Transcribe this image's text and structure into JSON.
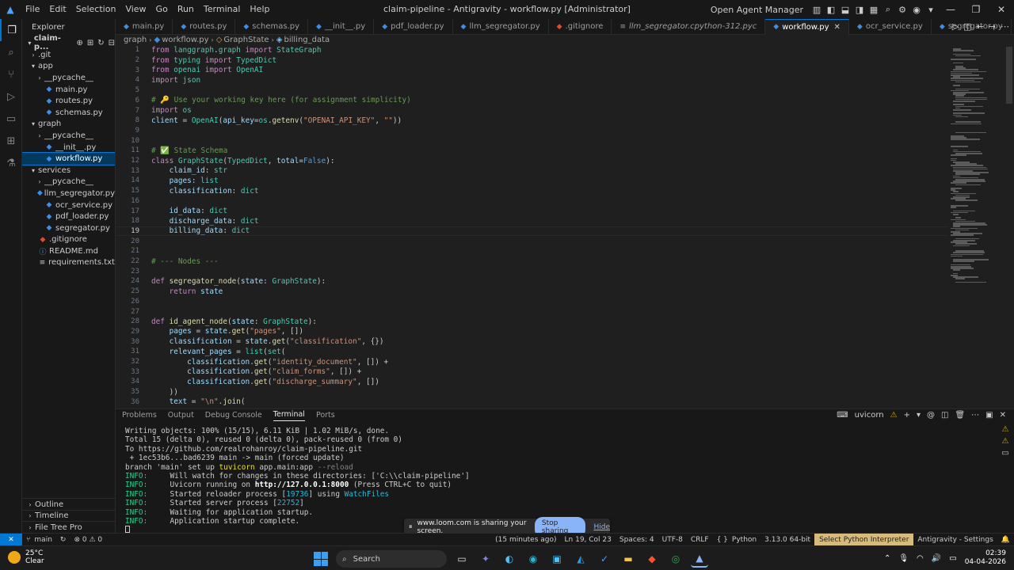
{
  "titlebar": {
    "menu": [
      "File",
      "Edit",
      "Selection",
      "View",
      "Go",
      "Run",
      "Terminal",
      "Help"
    ],
    "title": "claim-pipeline - Antigravity - workflow.py [Administrator]",
    "agent_manager": "Open Agent Manager"
  },
  "sidebar": {
    "header": "Explorer",
    "root": "claim-p...",
    "items": [
      {
        "label": ".git",
        "type": "folder",
        "depth": 1,
        "open": false
      },
      {
        "label": "app",
        "type": "folder",
        "depth": 1,
        "open": true
      },
      {
        "label": "__pycache__",
        "type": "folder",
        "depth": 2,
        "open": false
      },
      {
        "label": "main.py",
        "type": "py",
        "depth": 2
      },
      {
        "label": "routes.py",
        "type": "py",
        "depth": 2
      },
      {
        "label": "schemas.py",
        "type": "py",
        "depth": 2
      },
      {
        "label": "graph",
        "type": "folder",
        "depth": 1,
        "open": true
      },
      {
        "label": "__pycache__",
        "type": "folder",
        "depth": 2,
        "open": false
      },
      {
        "label": "__init__.py",
        "type": "py",
        "depth": 2
      },
      {
        "label": "workflow.py",
        "type": "py",
        "depth": 2,
        "selected": true
      },
      {
        "label": "services",
        "type": "folder",
        "depth": 1,
        "open": true
      },
      {
        "label": "__pycache__",
        "type": "folder",
        "depth": 2,
        "open": false
      },
      {
        "label": "llm_segregator.py",
        "type": "py",
        "depth": 2
      },
      {
        "label": "ocr_service.py",
        "type": "py",
        "depth": 2
      },
      {
        "label": "pdf_loader.py",
        "type": "py",
        "depth": 2
      },
      {
        "label": "segregator.py",
        "type": "py",
        "depth": 2
      },
      {
        "label": ".gitignore",
        "type": "git",
        "depth": 1
      },
      {
        "label": "README.md",
        "type": "md",
        "depth": 1
      },
      {
        "label": "requirements.txt",
        "type": "txt",
        "depth": 1
      }
    ],
    "bottom_panels": [
      "Outline",
      "Timeline",
      "File Tree Pro"
    ]
  },
  "tabs": [
    {
      "label": "main.py",
      "icon": "python"
    },
    {
      "label": "routes.py",
      "icon": "python"
    },
    {
      "label": "schemas.py",
      "icon": "python"
    },
    {
      "label": "__init__.py",
      "icon": "python"
    },
    {
      "label": "pdf_loader.py",
      "icon": "python"
    },
    {
      "label": "llm_segregator.py",
      "icon": "python"
    },
    {
      "label": ".gitignore",
      "icon": "git"
    },
    {
      "label": "llm_segregator.cpython-312.pyc",
      "icon": "binary"
    },
    {
      "label": "workflow.py",
      "icon": "python",
      "active": true
    },
    {
      "label": "ocr_service.py",
      "icon": "python"
    },
    {
      "label": "segregator.py",
      "icon": "python"
    }
  ],
  "breadcrumb": [
    "graph",
    "workflow.py",
    "GraphState",
    "billing_data"
  ],
  "editor": {
    "current_line": 19,
    "lines": [
      "from langgraph.graph import StateGraph",
      "from typing import TypedDict",
      "from openai import OpenAI",
      "import json",
      "",
      "# 🔑 Use your working key here (for assignment simplicity)",
      "import os",
      "client = OpenAI(api_key=os.getenv(\"OPENAI_API_KEY\", \"\"))",
      "",
      "",
      "# ✅ State Schema",
      "class GraphState(TypedDict, total=False):",
      "    claim_id: str",
      "    pages: list",
      "    classification: dict",
      "",
      "    id_data: dict",
      "    discharge_data: dict",
      "    billing_data: dict",
      "",
      "",
      "# --- Nodes ---",
      "",
      "def segregator_node(state: GraphState):",
      "    return state",
      "",
      "",
      "def id_agent_node(state: GraphState):",
      "    pages = state.get(\"pages\", [])",
      "    classification = state.get(\"classification\", {})",
      "    relevant_pages = list(set(",
      "        classification.get(\"identity_document\", []) +",
      "        classification.get(\"claim_forms\", []) +",
      "        classification.get(\"discharge_summary\", [])",
      "    ))",
      "    text = \"\\n\".join("
    ]
  },
  "panel": {
    "tabs": [
      "Problems",
      "Output",
      "Debug Console",
      "Terminal",
      "Ports"
    ],
    "active_tab": "Terminal",
    "terminal_name": "uvicorn",
    "terminal_lines": [
      "Writing objects: 100% (15/15), 6.11 KiB | 1.02 MiB/s, done.",
      "Total 15 (delta 0), reused 0 (delta 0), pack-reused 0 (from 0)",
      "To https://github.com/realrohanroy/claim-pipeline.git",
      " + 1ec53b6...bad6239 main -> main (forced update)",
      "branch 'main' set up tuvicorn app.main:app --reload",
      "INFO:     Will watch for changes in these directories: ['C:\\\\claim-pipeline']",
      "INFO:     Uvicorn running on http://127.0.0.1:8000 (Press CTRL+C to quit)",
      "INFO:     Started reloader process [19736] using WatchFiles",
      "INFO:     Started server process [22752]",
      "INFO:     Waiting for application startup.",
      "INFO:     Application startup complete."
    ]
  },
  "sharebar": {
    "message": "www.loom.com is sharing your screen.",
    "stop_label": "Stop sharing",
    "hide_label": "Hide"
  },
  "statusbar": {
    "branch": "main",
    "problems": "⊗ 0 ⚠ 0",
    "ago": "(15 minutes ago)",
    "position": "Ln 19, Col 23",
    "spaces": "Spaces: 4",
    "encoding": "UTF-8",
    "eol": "CRLF",
    "language": "Python",
    "version": "3.13.0 64-bit",
    "interpreter": "Select Python Interpreter",
    "settings": "Antigravity - Settings"
  },
  "taskbar": {
    "temperature": "25°C",
    "weather": "Clear",
    "search_placeholder": "Search",
    "time": "02:39",
    "date": "04-04-2026"
  },
  "colors": {
    "accent": "#0078d4",
    "share_button": "#8ab4f8",
    "interpreter_bg": "#d7ba7d"
  }
}
